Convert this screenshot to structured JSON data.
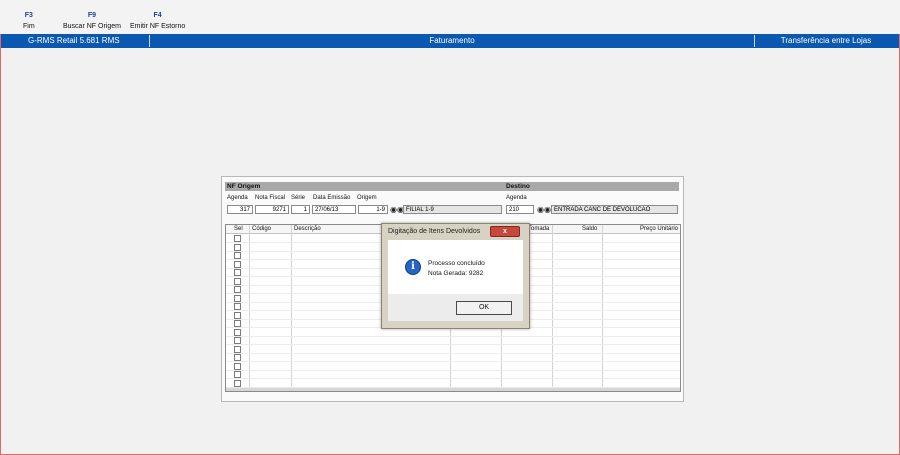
{
  "toolbar": {
    "buttons": [
      {
        "key": "F3",
        "label": "Fim"
      },
      {
        "key": "F9",
        "label": "Buscar NF Origem"
      },
      {
        "key": "F4",
        "label": "Emitir NF Estorno"
      }
    ]
  },
  "titlebar": {
    "app": "G-RMS Retail 5.681 RMS",
    "module": "Faturamento",
    "screen": "Transferência entre Lojas"
  },
  "nf_origem": {
    "header": "NF Origem",
    "labels": {
      "agenda": "Agenda",
      "nota_fiscal": "Nota Fiscal",
      "serie": "Série",
      "data_emissao": "Data Emissão",
      "origem": "Origem"
    },
    "values": {
      "agenda": "317",
      "nota_fiscal": "9271",
      "serie": "1",
      "data_emissao": "27/06/13",
      "origem": "1-9",
      "origem_desc": "FILIAL 1-9"
    }
  },
  "destino": {
    "header": "Destino",
    "labels": {
      "agenda": "Agenda"
    },
    "values": {
      "agenda": "210",
      "agenda_desc": "ENTRADA CANC DE DEVOLUCAO"
    }
  },
  "grid": {
    "columns": [
      "Sel",
      "Código",
      "Descrição",
      "Tomada",
      "Saldo",
      "Preço Unitário"
    ]
  },
  "dialog": {
    "title": "Digitação de Itens Devolvidos",
    "close_label": "x",
    "message_line1": "Processo concluído",
    "message_line2": "Nota Gerada: 9282",
    "ok_label": "OK"
  },
  "colors": {
    "titlebar": "#0b58b0",
    "section_header": "#a9a9a9",
    "close_button": "#c9473b",
    "info_icon": "#2465c3"
  },
  "icons": {
    "info": "information-icon",
    "search": "binoculars-icon"
  }
}
